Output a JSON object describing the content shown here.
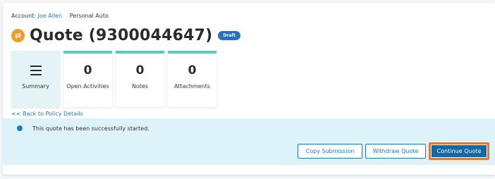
{
  "breadcrumb": {
    "account_prefix": "Account: ",
    "account_name": "Joe Allen",
    "product": "Personal Auto"
  },
  "header": {
    "icon": "swap-arrows-icon",
    "title": "Quote (9300044647)",
    "badge": "Draft"
  },
  "tiles": [
    {
      "label": "Summary",
      "icon": "hamburger-menu-icon"
    },
    {
      "count": "0",
      "label": "Open Activities"
    },
    {
      "count": "0",
      "label": "Notes"
    },
    {
      "count": "0",
      "label": "Attachments"
    }
  ],
  "back_link": "<< Back to Policy Details",
  "message": {
    "text": "This quote has been successfully started."
  },
  "actions": {
    "copy_submission": "Copy Submission",
    "withdraw_quote": "Withdraw Quote",
    "continue_quote": "Continue Quote"
  },
  "colors": {
    "accent_orange": "#f39a25",
    "link_blue": "#1d7ab8",
    "primary_button": "#0e6aa8",
    "tile_top": "#5ec8bf",
    "message_bg": "#def2fa",
    "focus_outline": "#e8772e"
  }
}
